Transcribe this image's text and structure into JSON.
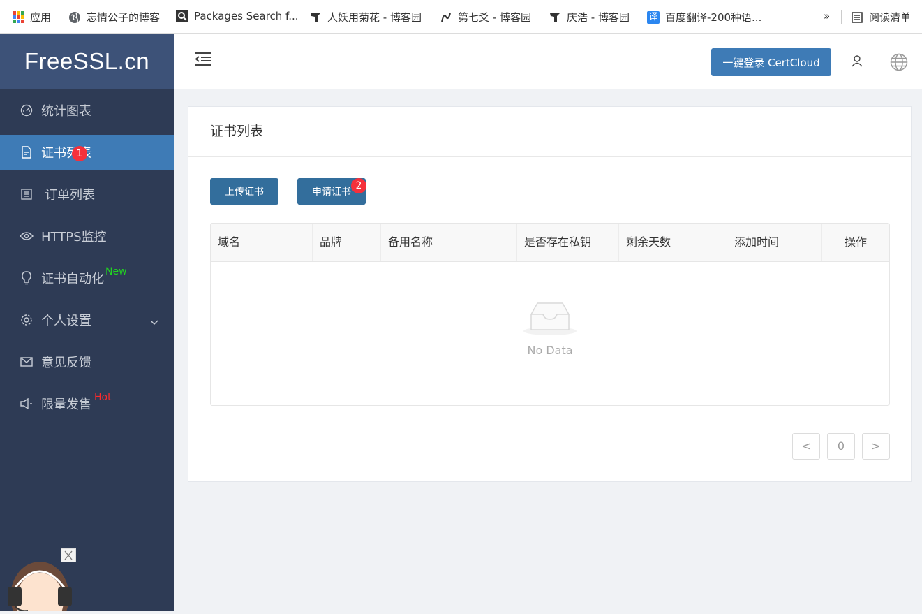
{
  "bookmarks": {
    "items": [
      {
        "label": "应用",
        "icon": "apps-grid-icon"
      },
      {
        "label": "忘情公子的博客",
        "icon": "globe-icon"
      },
      {
        "label": "Packages Search f...",
        "icon": "search-icon"
      },
      {
        "label": "人妖用菊花 - 博客园",
        "icon": "cnblogs-icon"
      },
      {
        "label": "第七爻 - 博客园",
        "icon": "cnblogs-icon"
      },
      {
        "label": "庆浩 - 博客园",
        "icon": "cnblogs-icon"
      },
      {
        "label": "百度翻译-200种语...",
        "icon": "translate-icon"
      }
    ],
    "more": "»",
    "reading_list": "阅读清单",
    "translate_glyph": "译"
  },
  "sidebar": {
    "logo": "FreeSSL.cn",
    "items": [
      {
        "label": "统计图表",
        "icon": "dashboard-icon"
      },
      {
        "label": "证书列表",
        "icon": "document-icon",
        "active": true
      },
      {
        "label": "订单列表",
        "icon": "list-icon"
      },
      {
        "label": "HTTPS监控",
        "icon": "eye-icon"
      },
      {
        "label": "证书自动化",
        "icon": "bulb-icon",
        "tag": "New"
      },
      {
        "label": "个人设置",
        "icon": "gear-icon",
        "has_submenu": true
      },
      {
        "label": "意见反馈",
        "icon": "mail-icon"
      },
      {
        "label": "限量发售",
        "icon": "megaphone-icon",
        "tag": "Hot"
      }
    ],
    "step_badge_1": "1"
  },
  "header": {
    "login_button": "一键登录 CertCloud"
  },
  "main": {
    "title": "证书列表",
    "upload_button": "上传证书",
    "apply_button": "申请证书",
    "step_badge_2": "2",
    "table": {
      "columns": [
        "域名",
        "品牌",
        "备用名称",
        "是否存在私钥",
        "剩余天数",
        "添加时间",
        "操作"
      ],
      "rows": [],
      "empty_text": "No Data"
    },
    "pagination": {
      "prev": "<",
      "page": "0",
      "next": ">"
    }
  },
  "colors": {
    "sidebar_bg": "#2e3b55",
    "active_item": "#3e7bb6",
    "button": "#336e9c",
    "badge": "#f5303b",
    "new_tag": "#21d421",
    "hot_tag": "#ff2a2a"
  }
}
